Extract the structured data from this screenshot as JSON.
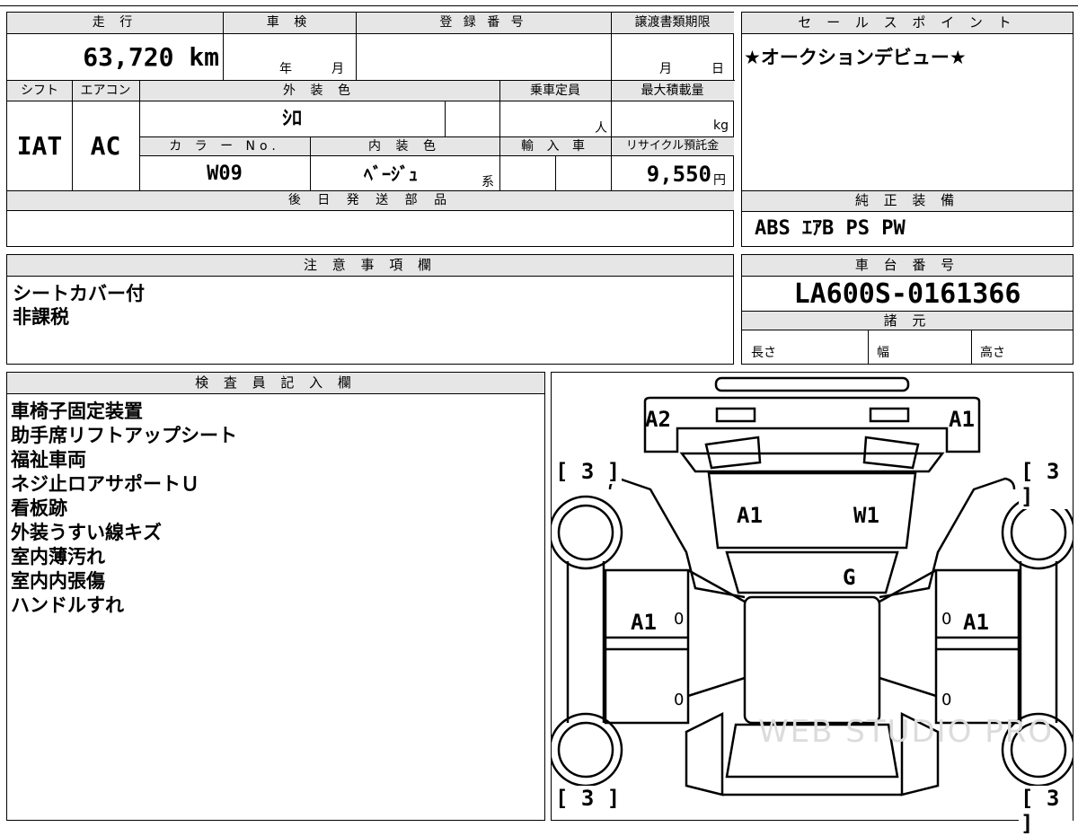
{
  "top_table": {
    "mileage_label": "走 行",
    "mileage_value": "63,720 km",
    "inspection_label": "車 検",
    "inspection_year": "年",
    "inspection_month": "月",
    "registration_label": "登 録 番 号",
    "transfer_label": "譲渡書類期限",
    "transfer_month": "月",
    "transfer_day": "日",
    "shift_label": "シフト",
    "shift_value": "IAT",
    "aircon_label": "エアコン",
    "aircon_value": "AC",
    "exterior_color_label": "外 装 色",
    "exterior_color_value": "ｼﾛ",
    "capacity_label": "乗車定員",
    "capacity_unit": "人",
    "max_load_label": "最大積載量",
    "max_load_unit": "kg",
    "color_no_label": "カ ラ ー No.",
    "color_no_value": "W09",
    "interior_color_label": "内 装 色",
    "interior_color_value": "ﾍﾞｰｼﾞｭ",
    "interior_color_suffix": "系",
    "import_label": "輸 入 車",
    "recycle_label": "リサイクル預託金",
    "recycle_value": "9,550",
    "recycle_unit": "円",
    "later_parts_label": "後 日 発 送 部 品"
  },
  "sales_point": {
    "label": "セ ー ル ス ポ イ ン ト",
    "text": "★オークションデビュー★"
  },
  "genuine_equipment": {
    "label": "純 正 装 備",
    "text": "ABS ｴｱB PS PW"
  },
  "caution": {
    "label": "注 意 事 項 欄",
    "lines": "シートカバー付\n非課税"
  },
  "chassis": {
    "label": "車 台 番 号",
    "value": "LA600S-0161366",
    "specs_label": "諸 元",
    "length": "長さ",
    "width": "幅",
    "height": "高さ"
  },
  "inspector": {
    "label": "検 査 員 記 入 欄",
    "lines": "車椅子固定装置\n助手席リフトアップシート\n福祉車両\nネジ止ロアサポートＵ\n看板跡\n外装うすい線キズ\n室内薄汚れ\n室内内張傷\nハンドルすれ"
  },
  "diagram": {
    "front_left": "A2",
    "front_right": "A1",
    "hood_left": "A1",
    "hood_right": "W1",
    "windshield": "G",
    "door_left": "A1",
    "door_right": "A1",
    "tire_fl": "[ 3 ]",
    "tire_fr": "[ 3 ]",
    "tire_rl": "[ 3 ]",
    "tire_rr": "[ 3 ]",
    "zero_1": "0",
    "zero_2": "0",
    "zero_3": "0",
    "zero_4": "0",
    "watermark": "WEB STUDIO PRO"
  }
}
